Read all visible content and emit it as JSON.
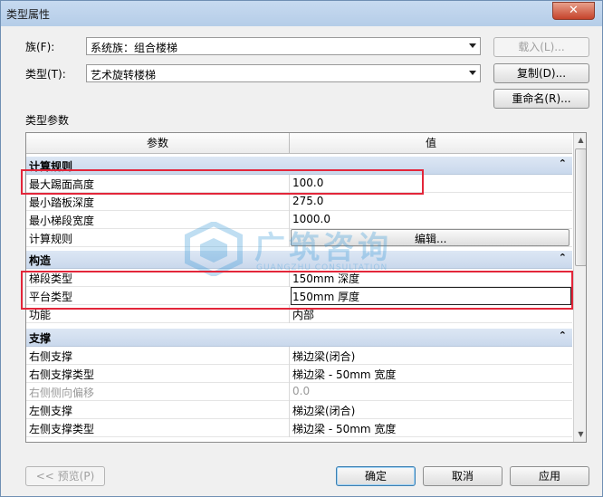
{
  "window": {
    "title": "类型属性",
    "close_glyph": "✕"
  },
  "family": {
    "label": "族(F):",
    "value": "系统族：组合楼梯",
    "load_button": "载入(L)..."
  },
  "type": {
    "label": "类型(T):",
    "value": "艺术旋转楼梯",
    "duplicate_button": "复制(D)...",
    "rename_button": "重命名(R)..."
  },
  "section_label": "类型参数",
  "grid": {
    "headers": {
      "param": "参数",
      "value": "值"
    },
    "groups": [
      {
        "name": "计算规则",
        "rows": [
          {
            "param": "最大踢面高度",
            "value": "100.0"
          },
          {
            "param": "最小踏板深度",
            "value": "275.0"
          },
          {
            "param": "最小梯段宽度",
            "value": "1000.0"
          },
          {
            "param": "计算规则",
            "value": "编辑..."
          }
        ]
      },
      {
        "name": "构造",
        "rows": [
          {
            "param": "梯段类型",
            "value": "150mm 深度"
          },
          {
            "param": "平台类型",
            "value": "150mm 厚度"
          },
          {
            "param": "功能",
            "value": "内部"
          }
        ]
      },
      {
        "name": "支撑",
        "rows": [
          {
            "param": "右侧支撑",
            "value": "梯边梁(闭合)"
          },
          {
            "param": "右侧支撑类型",
            "value": "梯边梁 - 50mm 宽度"
          },
          {
            "param": "右侧侧向偏移",
            "value": "0.0"
          },
          {
            "param": "左侧支撑",
            "value": "梯边梁(闭合)"
          },
          {
            "param": "左侧支撑类型",
            "value": "梯边梁 - 50mm 宽度"
          }
        ]
      }
    ],
    "collapse_glyph": "⌃"
  },
  "watermark": {
    "text": "广筑咨询",
    "sub": "GUANGZHU CONSULTATION"
  },
  "footer": {
    "preview_button": "<< 预览(P)",
    "ok_button": "确定",
    "cancel_button": "取消",
    "apply_button": "应用"
  },
  "colors": {
    "highlight": "#e3263a",
    "group_bg": "#d3e0f0",
    "watermark": "#3a9ad9"
  }
}
